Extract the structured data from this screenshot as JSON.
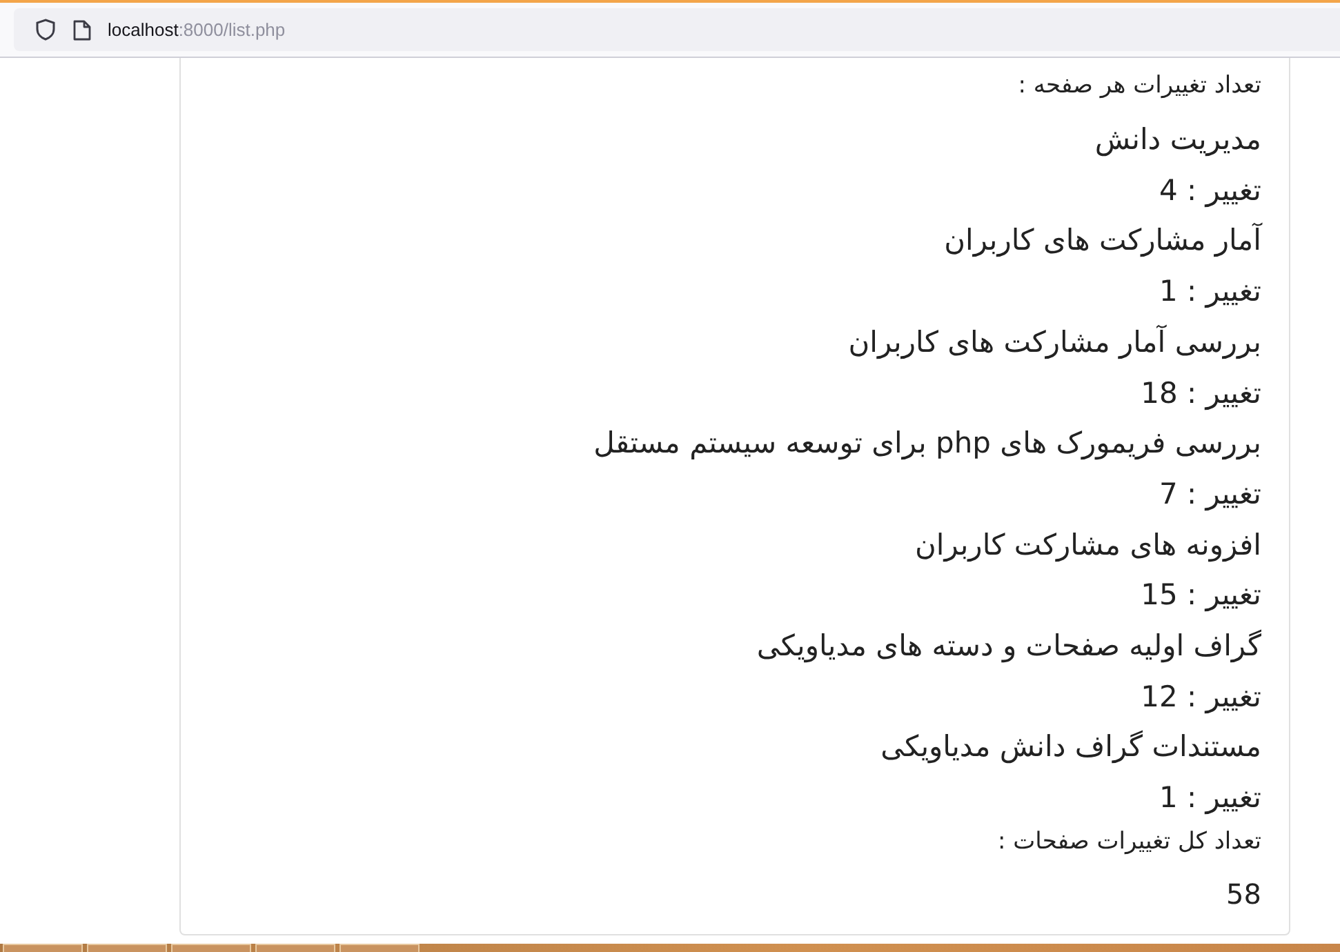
{
  "browser": {
    "url_host": "localhost",
    "url_rest": ":8000/list.php"
  },
  "heading": "تعداد تغییرات هر صفحه :",
  "pages": [
    {
      "title": "مدیریت دانش",
      "changes": "تغییر : 4"
    },
    {
      "title": "آمار مشارکت های کاربران",
      "changes": "تغییر : 1"
    },
    {
      "title": "بررسی آمار مشارکت های کاربران",
      "changes": "تغییر : 18"
    },
    {
      "title": "بررسی فریمورک های php برای توسعه سیستم مستقل",
      "changes": "تغییر : 7"
    },
    {
      "title": "افزونه های مشارکت کاربران",
      "changes": "تغییر : 15"
    },
    {
      "title": "گراف اولیه صفحات و دسته های مدیاویکی",
      "changes": "تغییر : 12"
    },
    {
      "title": "مستندات گراف دانش مدیاویکی",
      "changes": "تغییر : 1"
    }
  ],
  "total_label": "تعداد کل تغییرات صفحات :",
  "total": "58"
}
